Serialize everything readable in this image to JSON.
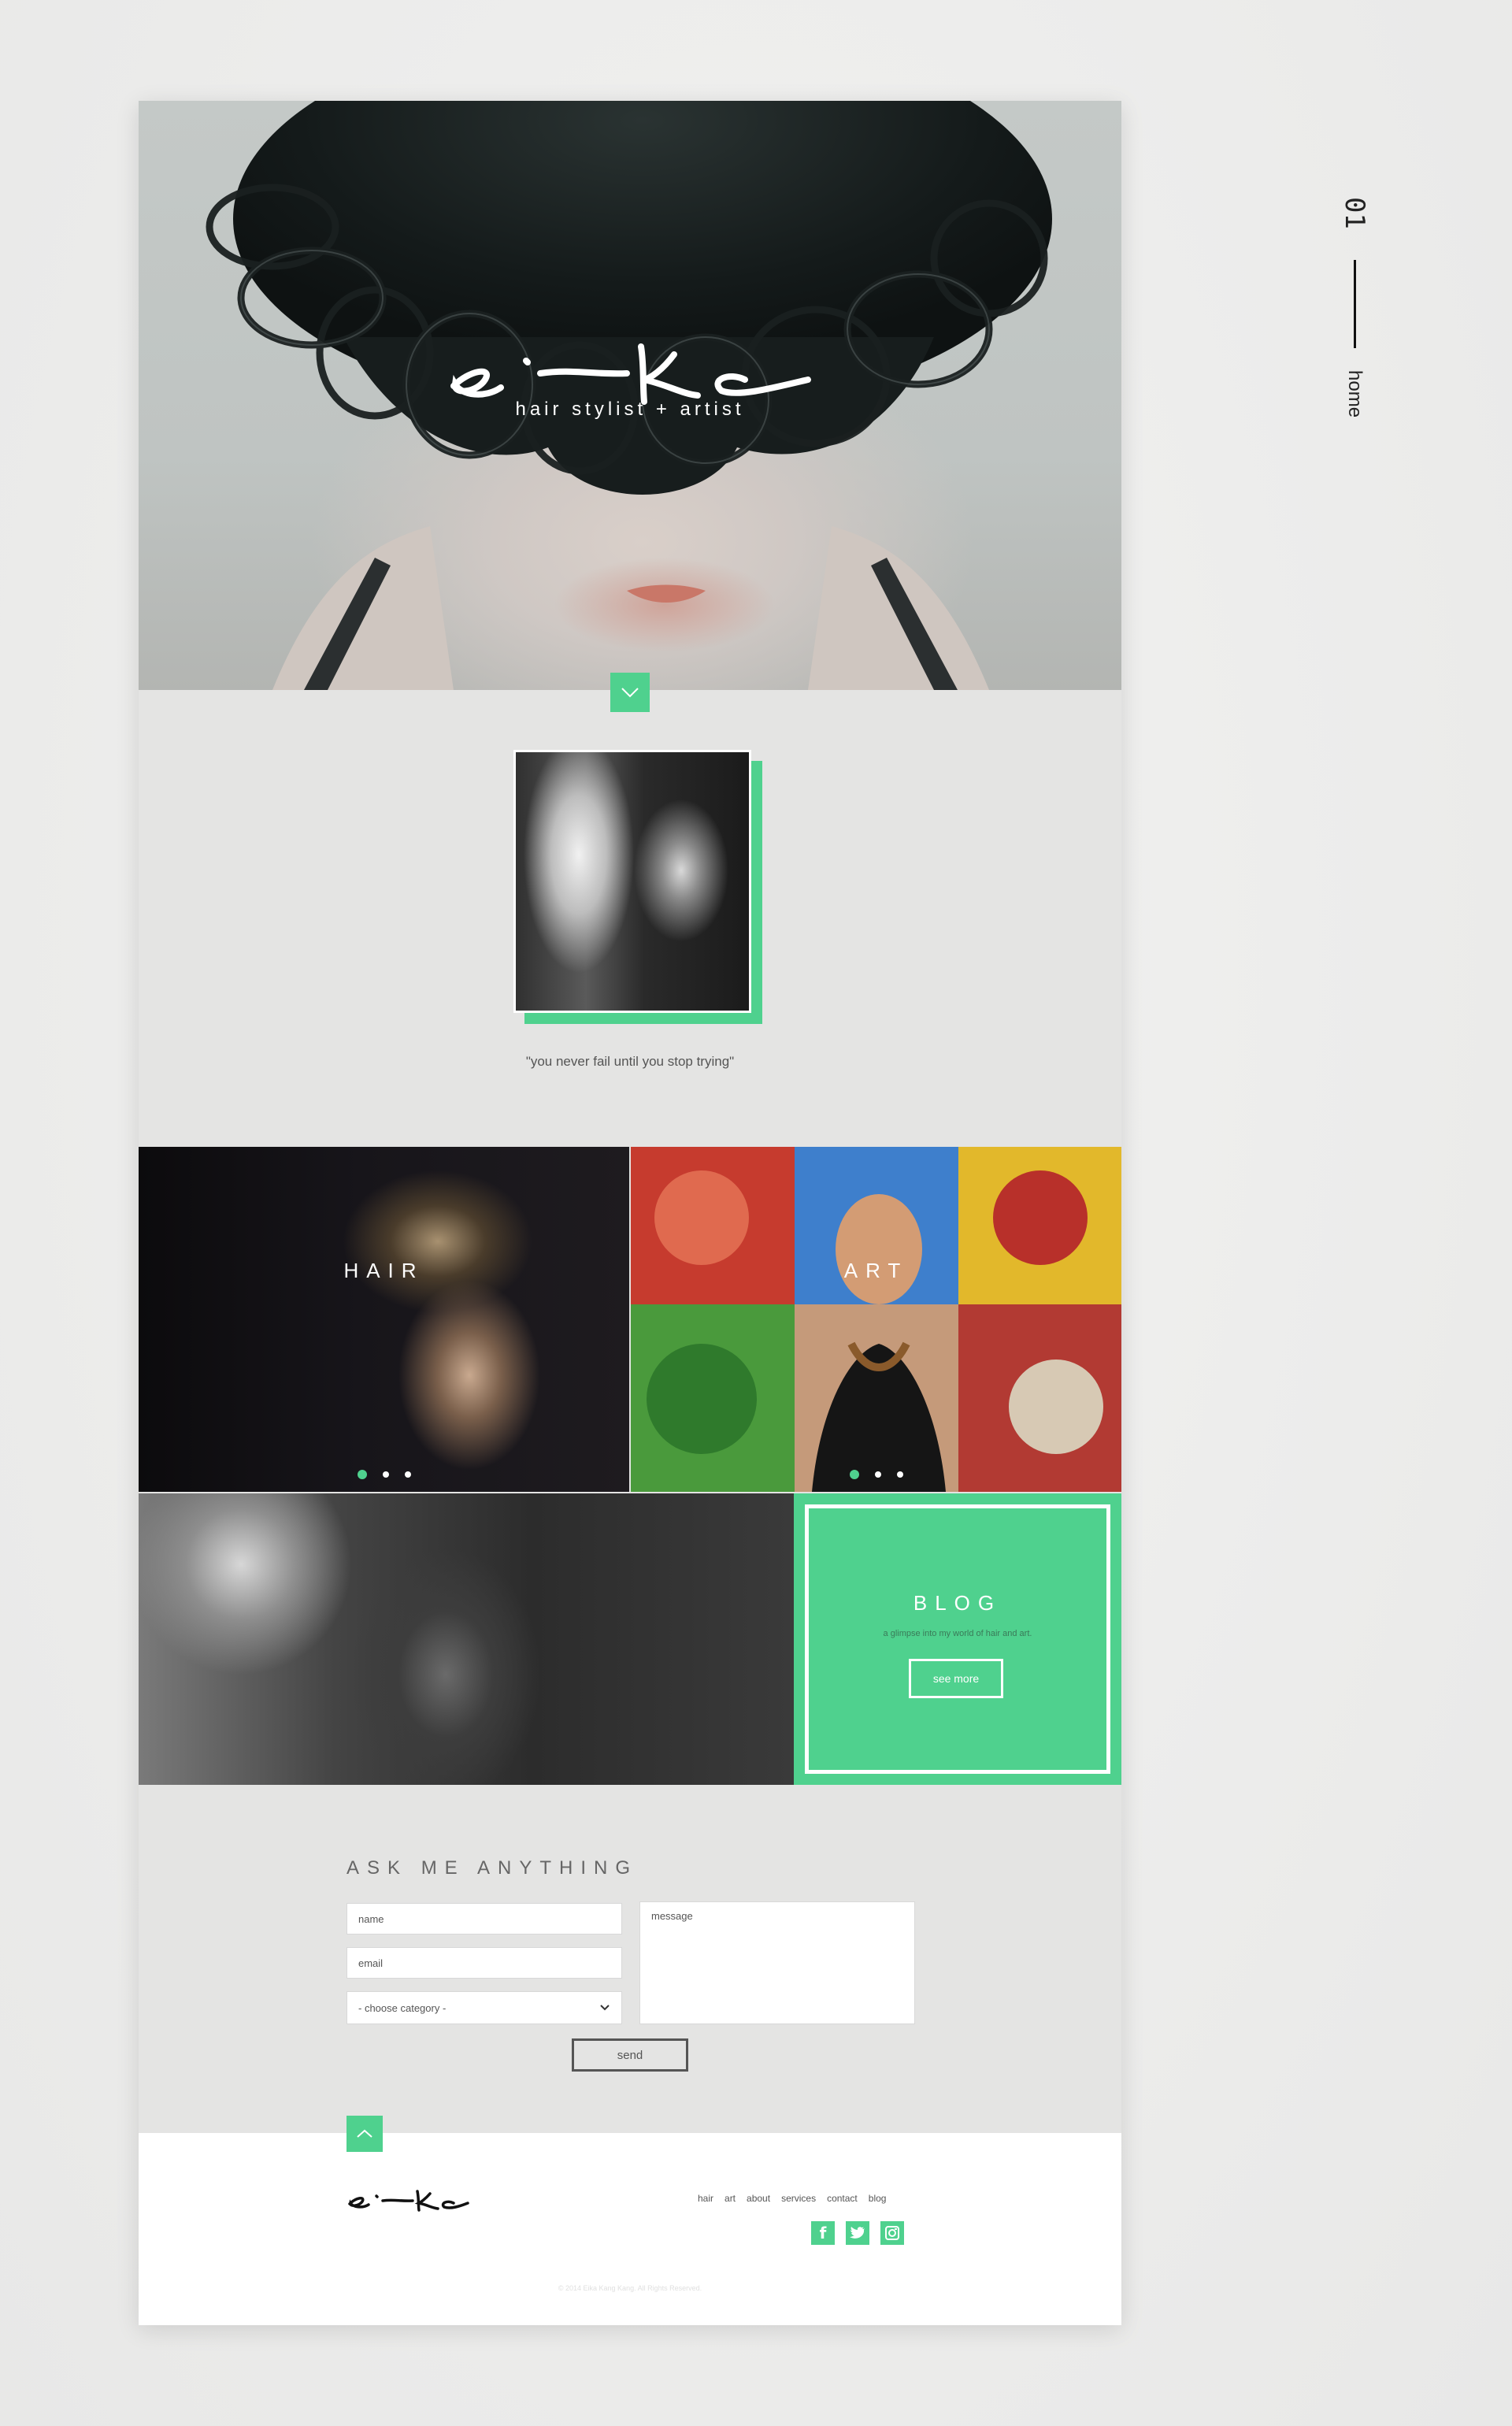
{
  "side": {
    "number": "01",
    "label": "home"
  },
  "hero": {
    "tagline": "hair stylist + artist",
    "logo_text": "e-ka"
  },
  "about": {
    "quote": "\"you never fail until you stop trying\""
  },
  "tiles": {
    "hair": {
      "label": "HAIR"
    },
    "art": {
      "label": "ART"
    },
    "blog": {
      "title": "BLOG",
      "subtitle": "a glimpse into my world of hair and art.",
      "button": "see more"
    }
  },
  "contact": {
    "title": "ASK ME ANYTHING",
    "name_placeholder": "name",
    "email_placeholder": "email",
    "category_selected": "- choose category -",
    "message_placeholder": "message",
    "send_label": "send"
  },
  "footer": {
    "nav": [
      "hair",
      "art",
      "about",
      "services",
      "contact",
      "blog"
    ],
    "social": [
      "facebook-icon",
      "twitter-icon",
      "instagram-icon"
    ],
    "copyright": "© 2014 Eika Kang Kang. All Rights Reserved."
  },
  "colors": {
    "accent": "#4fd18e",
    "background": "#e4e4e3"
  }
}
